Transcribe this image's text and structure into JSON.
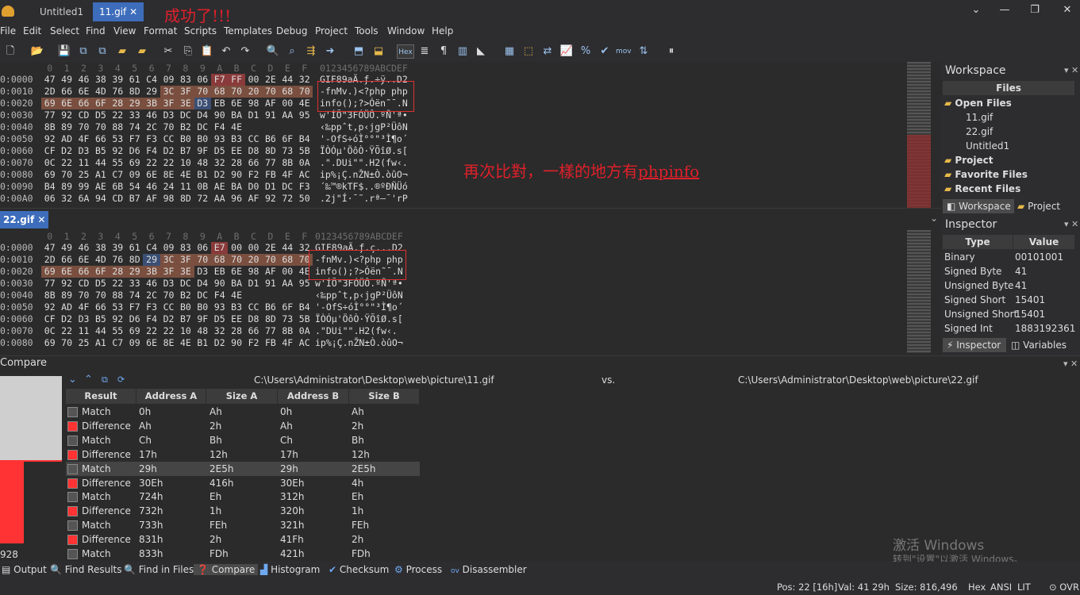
{
  "tabs": [
    "Untitled1",
    "11.gif"
  ],
  "annotation_top": "成功了!!!",
  "annotation_mid": "再次比對，一樣的地方有",
  "annotation_mid_link": "phpinfo",
  "menu": [
    "File",
    "Edit",
    "Select",
    "Find",
    "View",
    "Format",
    "Scripts",
    "Templates",
    "Debug",
    "Project",
    "Tools",
    "Window",
    "Help"
  ],
  "hex_header": [
    "0",
    "1",
    "2",
    "3",
    "4",
    "5",
    "6",
    "7",
    "8",
    "9",
    "A",
    "B",
    "C",
    "D",
    "E",
    "F"
  ],
  "ascii_header": "0123456789ABCDEF",
  "pane1": {
    "rows": [
      {
        "addr": "0:0000",
        "bytes": [
          "47",
          "49",
          "46",
          "38",
          "39",
          "61",
          "C4",
          "09",
          "83",
          "06",
          "F7",
          "FF",
          "00",
          "2E",
          "44",
          "32"
        ],
        "ascii": "GIF89aÄ.ƒ.÷ÿ..D2"
      },
      {
        "addr": "0:0010",
        "bytes": [
          "2D",
          "66",
          "6E",
          "4D",
          "76",
          "8D",
          "29",
          "3C",
          "3F",
          "70",
          "68",
          "70",
          "20",
          "70",
          "68",
          "70"
        ],
        "ascii": "-fnMv.)<?php php"
      },
      {
        "addr": "0:0020",
        "bytes": [
          "69",
          "6E",
          "66",
          "6F",
          "28",
          "29",
          "3B",
          "3F",
          "3E",
          "D3",
          "EB",
          "6E",
          "98",
          "AF",
          "00",
          "4E"
        ],
        "ascii": "info();?>Óën˜¯.N"
      },
      {
        "addr": "0:0030",
        "bytes": [
          "77",
          "92",
          "CD",
          "D5",
          "22",
          "33",
          "46",
          "D3",
          "DC",
          "D4",
          "90",
          "BA",
          "D1",
          "91",
          "AA",
          "95"
        ],
        "ascii": "w'ÍÕ\"3FÓÜÔ.ºÑ'ª•"
      },
      {
        "addr": "0:0040",
        "bytes": [
          "8B",
          "89",
          "70",
          "70",
          "88",
          "74",
          "2C",
          "70",
          "B2",
          "DC",
          "F4",
          "4E",
          "",
          "",
          "",
          ""
        ],
        "ascii": "‹‰ppˆt,p‹jgP²ÜôN"
      },
      {
        "addr": "0:0050",
        "bytes": [
          "92",
          "AD",
          "4F",
          "66",
          "53",
          "F7",
          "F3",
          "CC",
          "B0",
          "B0",
          "93",
          "B3",
          "CC",
          "B6",
          "6F",
          "B4"
        ],
        "ascii": "'-OfS÷óÌ°°\"³Ì¶o´"
      },
      {
        "addr": "0:0060",
        "bytes": [
          "CF",
          "D2",
          "D3",
          "B5",
          "92",
          "D6",
          "F4",
          "D2",
          "B7",
          "9F",
          "D5",
          "EE",
          "D8",
          "8D",
          "73",
          "5B"
        ],
        "ascii": "ÏÒÓµ'ÖôÒ·ŸÕîØ.s["
      },
      {
        "addr": "0:0070",
        "bytes": [
          "0C",
          "22",
          "11",
          "44",
          "55",
          "69",
          "22",
          "22",
          "10",
          "48",
          "32",
          "28",
          "66",
          "77",
          "8B",
          "0A"
        ],
        "ascii": ".\".DUi\"\".H2(fw‹."
      },
      {
        "addr": "0:0080",
        "bytes": [
          "69",
          "70",
          "25",
          "A1",
          "C7",
          "09",
          "6E",
          "8E",
          "4E",
          "B1",
          "D2",
          "90",
          "F2",
          "FB",
          "4F",
          "AC"
        ],
        "ascii": "ip%¡Ç.nŽN±Ò.òûO¬"
      },
      {
        "addr": "0:0090",
        "bytes": [
          "B4",
          "89",
          "99",
          "AE",
          "6B",
          "54",
          "46",
          "24",
          "11",
          "0B",
          "AE",
          "BA",
          "D0",
          "D1",
          "DC",
          "F3"
        ],
        "ascii": "´‰™®kTF$..®ºÐÑÜó"
      },
      {
        "addr": "0:00A0",
        "bytes": [
          "06",
          "32",
          "6A",
          "94",
          "CD",
          "B7",
          "AF",
          "98",
          "8D",
          "72",
          "AA",
          "96",
          "AF",
          "92",
          "72",
          "50"
        ],
        "ascii": ".2j\"Í·¯˜.rª–¯'rP"
      }
    ]
  },
  "pane2_tab": "22.gif",
  "pane2": {
    "rows": [
      {
        "addr": "0:0000",
        "bytes": [
          "47",
          "49",
          "46",
          "38",
          "39",
          "61",
          "C4",
          "09",
          "83",
          "06",
          "E7",
          "00",
          "00",
          "2E",
          "44",
          "32"
        ],
        "ascii": "GIF89aÄ.ƒ.ç...D2"
      },
      {
        "addr": "0:0010",
        "bytes": [
          "2D",
          "66",
          "6E",
          "4D",
          "76",
          "8D",
          "29",
          "3C",
          "3F",
          "70",
          "68",
          "70",
          "20",
          "70",
          "68",
          "70"
        ],
        "ascii": "-fnMv.)<?php php"
      },
      {
        "addr": "0:0020",
        "bytes": [
          "69",
          "6E",
          "66",
          "6F",
          "28",
          "29",
          "3B",
          "3F",
          "3E",
          "D3",
          "EB",
          "6E",
          "98",
          "AF",
          "00",
          "4E"
        ],
        "ascii": "info();?>Óën˜¯.N"
      },
      {
        "addr": "0:0030",
        "bytes": [
          "77",
          "92",
          "CD",
          "D5",
          "22",
          "33",
          "46",
          "D3",
          "DC",
          "D4",
          "90",
          "BA",
          "D1",
          "91",
          "AA",
          "95"
        ],
        "ascii": "w'ÍÕ\"3FÓÜÔ.ºÑ'ª•"
      },
      {
        "addr": "0:0040",
        "bytes": [
          "8B",
          "89",
          "70",
          "70",
          "88",
          "74",
          "2C",
          "70",
          "B2",
          "DC",
          "F4",
          "4E",
          "",
          "",
          "",
          ""
        ],
        "ascii": "‹‰ppˆt,p‹jgP²ÜôN"
      },
      {
        "addr": "0:0050",
        "bytes": [
          "92",
          "AD",
          "4F",
          "66",
          "53",
          "F7",
          "F3",
          "CC",
          "B0",
          "B0",
          "93",
          "B3",
          "CC",
          "B6",
          "6F",
          "B4"
        ],
        "ascii": "'-OfS÷óÌ°°\"³Ì¶o´"
      },
      {
        "addr": "0:0060",
        "bytes": [
          "CF",
          "D2",
          "D3",
          "B5",
          "92",
          "D6",
          "F4",
          "D2",
          "B7",
          "9F",
          "D5",
          "EE",
          "D8",
          "8D",
          "73",
          "5B"
        ],
        "ascii": "ÏÒÓµ'ÖôÒ·ŸÕîØ.s["
      },
      {
        "addr": "0:0070",
        "bytes": [
          "0C",
          "22",
          "11",
          "44",
          "55",
          "69",
          "22",
          "22",
          "10",
          "48",
          "32",
          "28",
          "66",
          "77",
          "8B",
          "0A"
        ],
        "ascii": ".\"DUi\"\".H2(fw‹."
      },
      {
        "addr": "0:0080",
        "bytes": [
          "69",
          "70",
          "25",
          "A1",
          "C7",
          "09",
          "6E",
          "8E",
          "4E",
          "B1",
          "D2",
          "90",
          "F2",
          "FB",
          "4F",
          "AC"
        ],
        "ascii": "ip%¡Ç.nŽN±Ò.òûO¬"
      }
    ]
  },
  "workspace": {
    "title": "Workspace",
    "files_header": "Files",
    "open_files_label": "Open Files",
    "open_files": [
      "11.gif",
      "22.gif",
      "Untitled1"
    ],
    "project_label": "Project",
    "favorite_label": "Favorite Files",
    "recent_label": "Recent Files",
    "tab_workspace": "Workspace",
    "tab_project": "Project"
  },
  "inspector": {
    "title": "Inspector",
    "col_type": "Type",
    "col_value": "Value",
    "rows": [
      {
        "type": "Binary",
        "value": "00101001"
      },
      {
        "type": "Signed Byte",
        "value": "41"
      },
      {
        "type": "Unsigned Byte",
        "value": "41"
      },
      {
        "type": "Signed Short",
        "value": "15401"
      },
      {
        "type": "Unsigned Short",
        "value": "15401"
      },
      {
        "type": "Signed Int",
        "value": "1883192361"
      }
    ],
    "tab_inspector": "Inspector",
    "tab_variables": "Variables"
  },
  "compare": {
    "title": "Compare",
    "file_a": "C:\\Users\\Administrator\\Desktop\\web\\picture\\11.gif",
    "vs": "vs.",
    "file_b": "C:\\Users\\Administrator\\Desktop\\web\\picture\\22.gif",
    "headers": [
      "Result",
      "Address A",
      "Size A",
      "Address B",
      "Size B"
    ],
    "rows": [
      {
        "result": "Match",
        "addr_a": "0h",
        "size_a": "Ah",
        "addr_b": "0h",
        "size_b": "Ah"
      },
      {
        "result": "Difference",
        "addr_a": "Ah",
        "size_a": "2h",
        "addr_b": "Ah",
        "size_b": "2h"
      },
      {
        "result": "Match",
        "addr_a": "Ch",
        "size_a": "Bh",
        "addr_b": "Ch",
        "size_b": "Bh"
      },
      {
        "result": "Difference",
        "addr_a": "17h",
        "size_a": "12h",
        "addr_b": "17h",
        "size_b": "12h"
      },
      {
        "result": "Match",
        "addr_a": "29h",
        "size_a": "2E5h",
        "addr_b": "29h",
        "size_b": "2E5h"
      },
      {
        "result": "Difference",
        "addr_a": "30Eh",
        "size_a": "416h",
        "addr_b": "30Eh",
        "size_b": "4h"
      },
      {
        "result": "Match",
        "addr_a": "724h",
        "size_a": "Eh",
        "addr_b": "312h",
        "size_b": "Eh"
      },
      {
        "result": "Difference",
        "addr_a": "732h",
        "size_a": "1h",
        "addr_b": "320h",
        "size_b": "1h"
      },
      {
        "result": "Match",
        "addr_a": "733h",
        "size_a": "FEh",
        "addr_b": "321h",
        "size_b": "FEh"
      },
      {
        "result": "Difference",
        "addr_a": "831h",
        "size_a": "2h",
        "addr_b": "41Fh",
        "size_b": "2h"
      },
      {
        "result": "Match",
        "addr_a": "833h",
        "size_a": "FDh",
        "addr_b": "421h",
        "size_b": "FDh"
      }
    ],
    "left_number": "928"
  },
  "watermark": {
    "line1": "激活 Windows",
    "line2": "转到\"设置\"以激活 Windows。"
  },
  "bottom_tabs": [
    "Output",
    "Find Results",
    "Find in Files",
    "Compare",
    "Histogram",
    "Checksum",
    "Process",
    "Disassembler"
  ],
  "status": {
    "pos": "Pos: 22 [16h]",
    "val": "Val: 41 29h",
    "size": "Size: 816,496",
    "hex": "Hex",
    "ansi": "ANSI",
    "lit": "LIT",
    "ovr": "OVR"
  },
  "colors": {
    "match": "#555555",
    "difference": "#ff3333",
    "accent": "#3d6dbb",
    "annotation": "#e0202a"
  }
}
